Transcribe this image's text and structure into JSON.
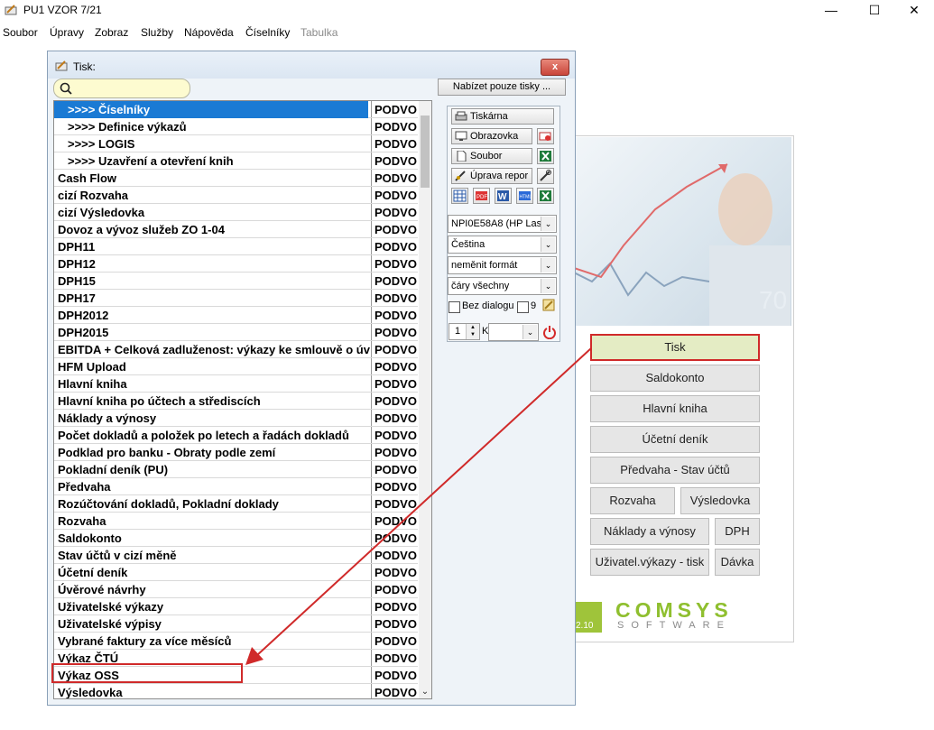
{
  "window": {
    "title": "PU1 VZOR 7/21",
    "minimize": "—",
    "maximize": "☐",
    "close": "✕"
  },
  "menu": [
    "Soubor",
    "Úpravy",
    "Zobraz",
    "Služby",
    "Nápověda",
    "Číselníky",
    "Tabulka"
  ],
  "background_panel": {
    "buttons": [
      "Tisk",
      "Saldokonto",
      "Hlavní kniha",
      "Účetní deník",
      "Předvaha - Stav účtů",
      "Rozvaha",
      "Výsledovka",
      "Náklady a výnosy",
      "DPH",
      "Uživatel.výkazy - tisk",
      "Dávka"
    ],
    "version": "2.10",
    "logo_main": "COMSYS",
    "logo_sub": "SOFTWARE"
  },
  "dialog": {
    "title": "Tisk:",
    "close": "x",
    "offer_button": "Nabízet pouze tisky ...",
    "list": [
      {
        "name": ">>>> Číselníky",
        "type": "PODVO"
      },
      {
        "name": ">>>> Definice výkazů",
        "type": "PODVO"
      },
      {
        "name": ">>>> LOGIS",
        "type": "PODVO"
      },
      {
        "name": ">>>> Uzavření a otevření knih",
        "type": "PODVO"
      },
      {
        "name": "Cash Flow",
        "type": "PODVO"
      },
      {
        "name": "cizí Rozvaha",
        "type": "PODVO"
      },
      {
        "name": "cizí Výsledovka",
        "type": "PODVO"
      },
      {
        "name": "Dovoz a vývoz služeb ZO 1-04",
        "type": "PODVO"
      },
      {
        "name": "DPH11",
        "type": "PODVO"
      },
      {
        "name": "DPH12",
        "type": "PODVO"
      },
      {
        "name": "DPH15",
        "type": "PODVO"
      },
      {
        "name": "DPH17",
        "type": "PODVO"
      },
      {
        "name": "DPH2012",
        "type": "PODVO"
      },
      {
        "name": "DPH2015",
        "type": "PODVO"
      },
      {
        "name": "EBITDA + Celková zadluženost: výkazy ke smlouvě o úv",
        "type": "PODVO"
      },
      {
        "name": "HFM Upload",
        "type": "PODVO"
      },
      {
        "name": "Hlavní kniha",
        "type": "PODVO"
      },
      {
        "name": "Hlavní kniha po účtech a střediscích",
        "type": "PODVO"
      },
      {
        "name": "Náklady a výnosy",
        "type": "PODVO"
      },
      {
        "name": "Počet dokladů a položek po letech a řadách dokladů",
        "type": "PODVO"
      },
      {
        "name": "Podklad pro banku - Obraty podle zemí",
        "type": "PODVO"
      },
      {
        "name": "Pokladní deník (PU)",
        "type": "PODVO"
      },
      {
        "name": "Předvaha",
        "type": "PODVO"
      },
      {
        "name": "Rozúčtování dokladů, Pokladní doklady",
        "type": "PODVO"
      },
      {
        "name": "Rozvaha",
        "type": "PODVO"
      },
      {
        "name": "Saldokonto",
        "type": "PODVO"
      },
      {
        "name": "Stav účtů v cizí měně",
        "type": "PODVO"
      },
      {
        "name": "Účetní deník",
        "type": "PODVO"
      },
      {
        "name": "Úvěrové návrhy",
        "type": "PODVO"
      },
      {
        "name": "Uživatelské výkazy",
        "type": "PODVO"
      },
      {
        "name": "Uživatelské výpisy",
        "type": "PODVO"
      },
      {
        "name": "Vybrané faktury za více měsíců",
        "type": "PODVO"
      },
      {
        "name": "Výkaz ČTÚ",
        "type": "PODVO"
      },
      {
        "name": "Výkaz OSS",
        "type": "PODVO"
      },
      {
        "name": "Výsledovka",
        "type": "PODVO"
      }
    ],
    "options": {
      "printer_btn": "Tiskárna",
      "screen_btn": "Obrazovka",
      "file_btn": "Soubor",
      "report_btn": "Úprava repor",
      "printer_combo": "NPI0E58A8 (HP Lase",
      "language_combo": "Čeština",
      "format_combo": "neměnit formát",
      "lines_combo": "čáry všechny",
      "no_dialog_label": "Bez dialogu",
      "nine_label": "9",
      "copies": "1",
      "k_label": "K"
    }
  },
  "colors": {
    "selection": "#1a7ad4",
    "annotation_red": "#d02a2a",
    "logo_green": "#8fbf2f"
  }
}
